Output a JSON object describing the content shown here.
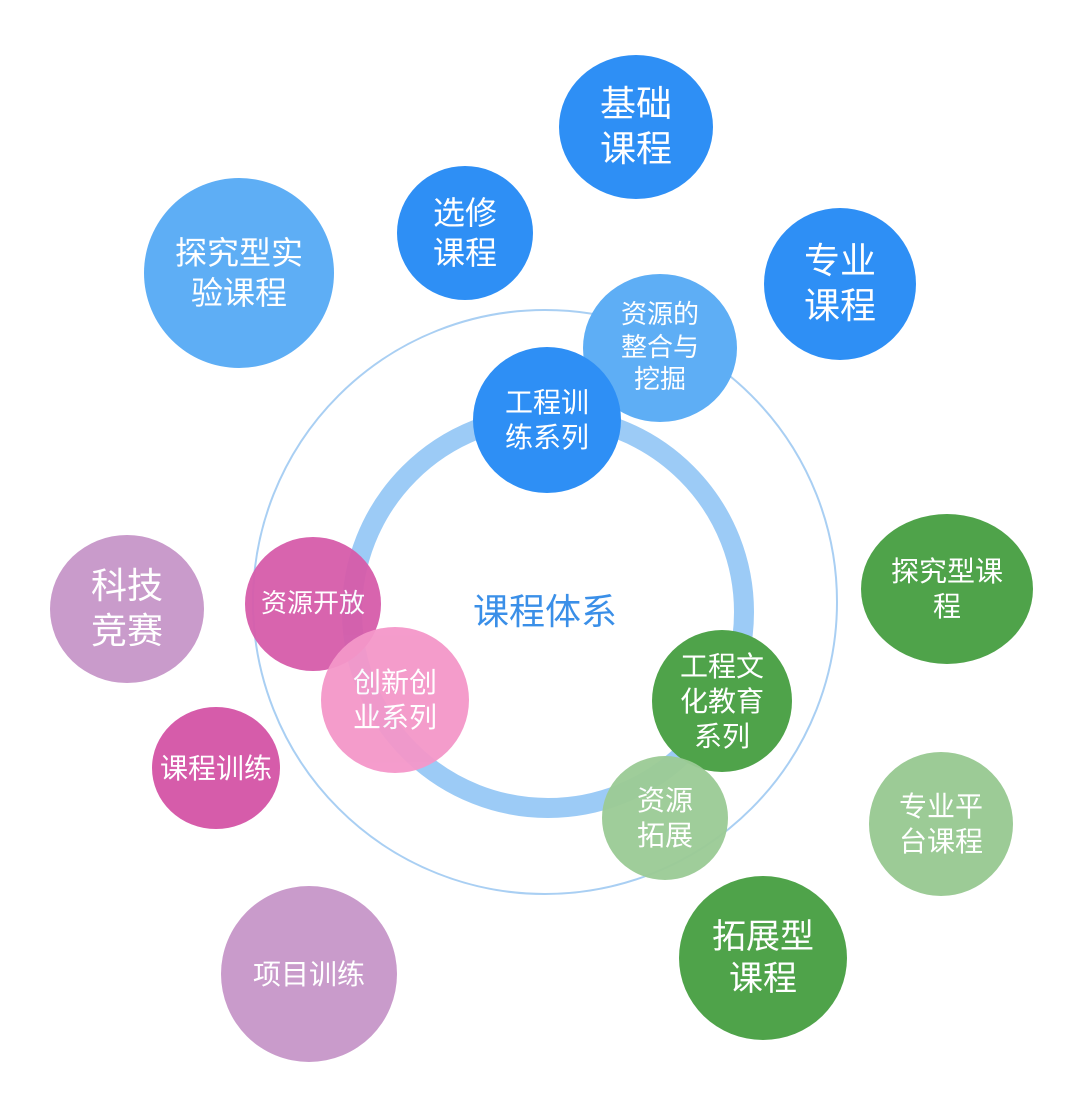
{
  "center_title": "课程体系",
  "colors": {
    "blue_dark": "#2e8ff5",
    "blue_light": "#5eaef5",
    "blue_ring": "#9ccbf6",
    "outer_ring": "#a9cff3",
    "green_dark": "#4fa34a",
    "green_light": "#9ccb96",
    "magenta": "#d65caa",
    "purple_light": "#c99bcb",
    "pink": "#f497c9"
  },
  "bubbles": {
    "jichu": "基础\n课程",
    "xuanxiu": "选修\n课程",
    "zhuanye": "专业\n课程",
    "tanjiu_shiyan": "探究型实\n验课程",
    "ziyuan_zhenghe": "资源的\n整合与\n挖掘",
    "gongcheng_xunlian": "工程训\n练系列",
    "keji": "科技\n竞赛",
    "ziyuan_kaifang": "资源开放",
    "chuangxin": "创新创\n业系列",
    "kecheng_xunlian": "课程训练",
    "xiangmu": "项目训练",
    "tanjiu_kecheng": "探究型课\n程",
    "gongcheng_wenhua": "工程文\n化教育\n系列",
    "ziyuan_tuozhan": "资源\n拓展",
    "zhuanye_pingtai": "专业平\n台课程",
    "tuozhan": "拓展型\n课程"
  }
}
